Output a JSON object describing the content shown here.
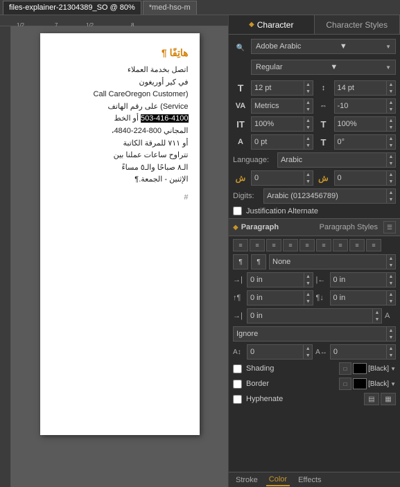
{
  "tabs": [
    {
      "label": "files-explainer-21304389_SO @ 80%",
      "active": true,
      "modified": false
    },
    {
      "label": "*med-hso-m",
      "active": false,
      "modified": true
    }
  ],
  "ruler": {
    "marks": [
      "1/2",
      "7",
      "1/2",
      "8"
    ]
  },
  "document": {
    "title": "هاتِفًا ¶",
    "paragraphs": [
      "اتصل بخدمة العملاء",
      "في كير أوريغون",
      "(Call CareOregon Customer",
      "Service) على رقم الهاتف",
      "503-416-4100 أو الخط",
      "المجاني  800-224-4840،",
      "أو ٧١١ للمرقة الكاتبة",
      "تتراوح ساعات عملنا بين",
      "الـ٨ صباحًا والـ٥ مساءً",
      "الإثنين - الجمعة.¶"
    ],
    "hash": "#"
  },
  "character_panel": {
    "tab_label": "Character",
    "styles_tab_label": "Character Styles",
    "font_name": "Adobe Arabic",
    "font_style": "Regular",
    "fields": {
      "font_size_label": "T",
      "font_size_value": "12 pt",
      "leading_value": "14 pt",
      "kerning_label": "VA",
      "kerning_value": "Metrics",
      "tracking_value": "-10",
      "vert_scale_value": "100%",
      "horiz_scale_value": "100%",
      "baseline_shift_value": "0 pt",
      "rotation_value": "0°",
      "language_label": "Language:",
      "language_value": "Arabic",
      "tcyup_value": "0",
      "tcydown_value": "0",
      "digits_label": "Digits:",
      "digits_value": "Arabic (0123456789)",
      "justification_alt_label": "Justification Alternate"
    }
  },
  "paragraph_panel": {
    "tab_label": "Paragraph",
    "styles_tab_label": "Paragraph Styles",
    "align_buttons": [
      "≡←",
      "≡",
      "≡→",
      "≡↔",
      "≡|←",
      "≡|→",
      "↔≡",
      "←≡",
      "→≡"
    ],
    "indent_left_label": "←",
    "indent_right_label": "→",
    "space_before_label": "↑",
    "space_after_label": "↓",
    "dropcap_lines": "0",
    "dropcap_chars": "0",
    "none_dropdown": "None",
    "shading_label": "Shading",
    "shading_color": "[Black]",
    "border_label": "Border",
    "border_color": "[Black]",
    "hyphenate_label": "Hyphenate",
    "ignore_dropdown": "Ignore",
    "para_indent": {
      "left": "0 in",
      "right": "0 in",
      "space_before": "0 in",
      "space_after": "0 in",
      "last_line": "0 in"
    }
  },
  "bottom_tabs": {
    "stroke_label": "Stroke",
    "color_label": "Color",
    "effects_label": "Effects"
  }
}
